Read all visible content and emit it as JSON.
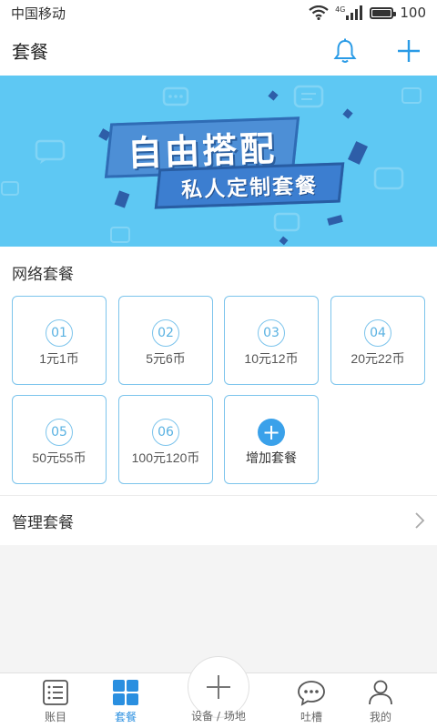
{
  "status_bar": {
    "carrier": "中国移动",
    "network": "4G",
    "battery": "100"
  },
  "header": {
    "title": "套餐"
  },
  "banner": {
    "title": "自由搭配",
    "subtitle": "私人定制套餐"
  },
  "network_plans": {
    "title": "网络套餐",
    "items": [
      {
        "num": "01",
        "label": "1元1币"
      },
      {
        "num": "02",
        "label": "5元6币"
      },
      {
        "num": "03",
        "label": "10元12币"
      },
      {
        "num": "04",
        "label": "20元22币"
      },
      {
        "num": "05",
        "label": "50元55币"
      },
      {
        "num": "06",
        "label": "100元120币"
      }
    ],
    "add_label": "增加套餐"
  },
  "manage": {
    "label": "管理套餐"
  },
  "tabbar": {
    "items": [
      {
        "label": "账目",
        "icon": "list-icon"
      },
      {
        "label": "套餐",
        "icon": "grid-icon"
      },
      {
        "label": "设备 / 场地",
        "icon": "plus-icon"
      },
      {
        "label": "吐槽",
        "icon": "chat-bubble-icon"
      },
      {
        "label": "我的",
        "icon": "person-icon"
      }
    ],
    "active_index": 1
  },
  "colors": {
    "accent": "#2a8fe0",
    "banner_bg": "#5ec8f3",
    "card_border": "#7cc4ec"
  }
}
